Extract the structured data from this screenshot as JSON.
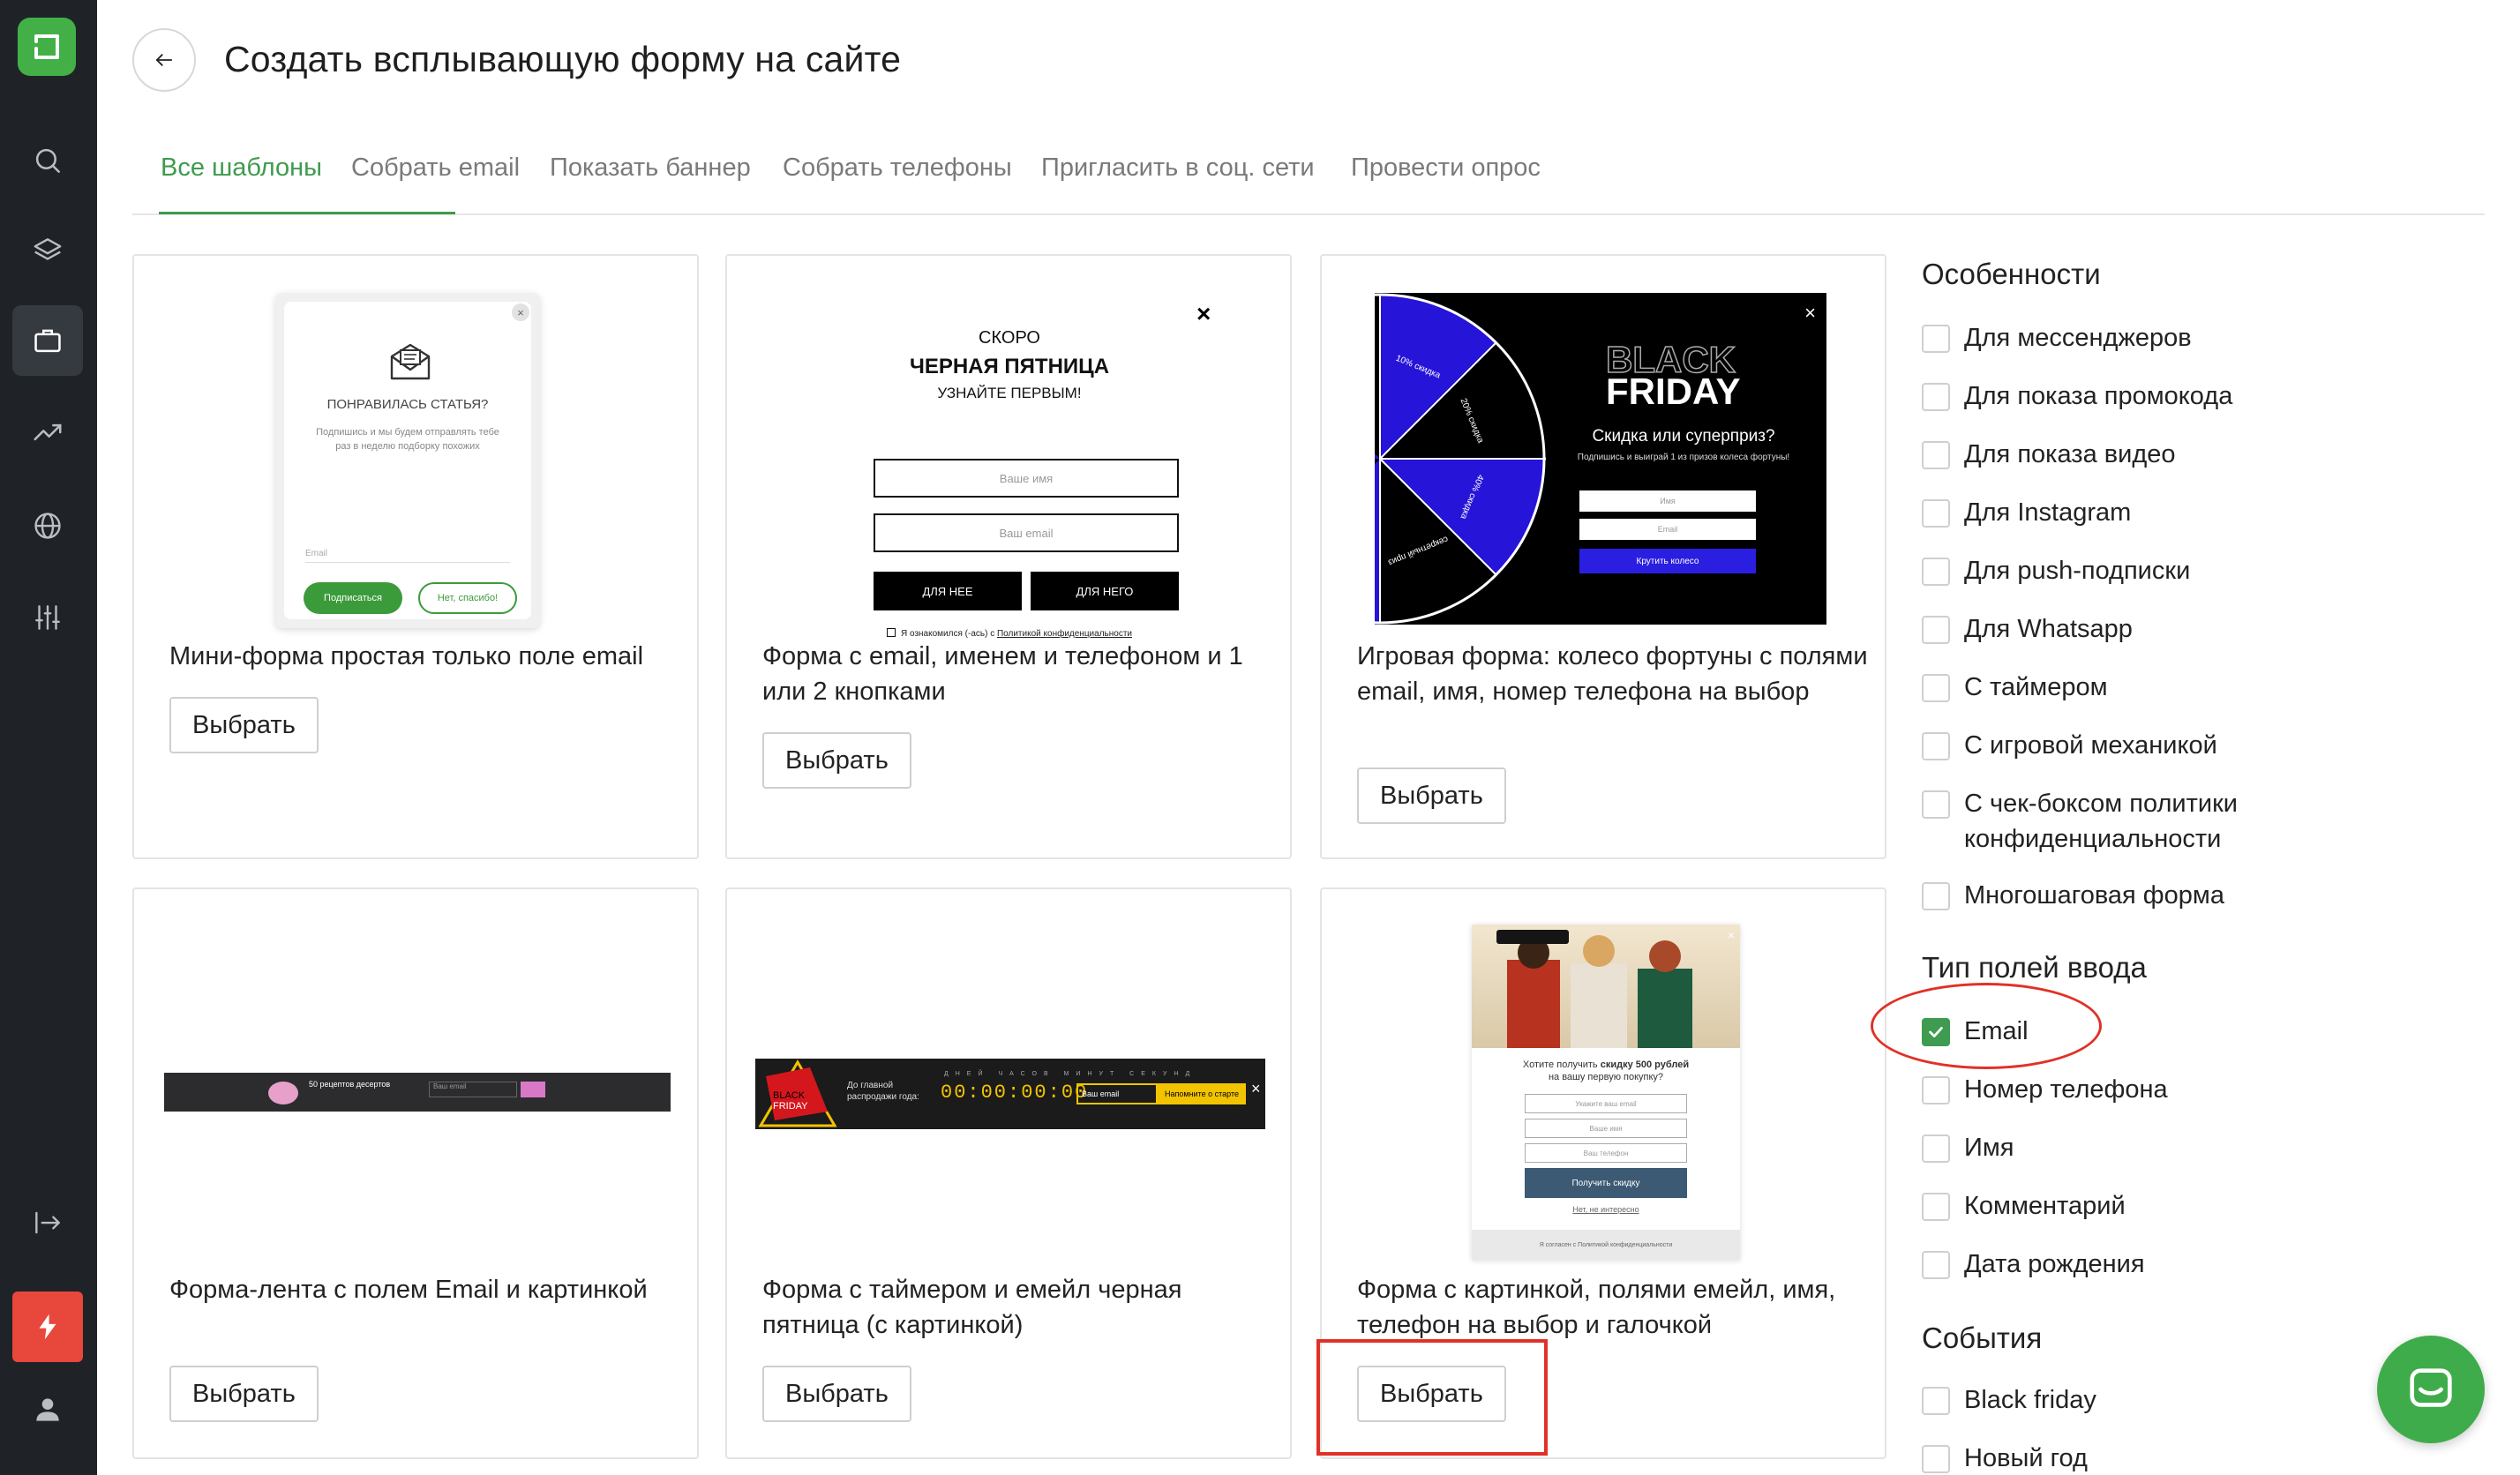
{
  "header": {
    "title": "Создать всплывающую форму на сайте"
  },
  "tabs": [
    {
      "label": "Все шаблоны",
      "active": true
    },
    {
      "label": "Собрать email"
    },
    {
      "label": "Показать баннер"
    },
    {
      "label": "Собрать телефоны"
    },
    {
      "label": "Пригласить в соц. сети"
    },
    {
      "label": "Провести опрос"
    }
  ],
  "choose_label": "Выбрать",
  "cards": [
    {
      "title": "Мини-форма простая только поле email",
      "preview": {
        "heading": "ПОНРАВИЛАСЬ СТАТЬЯ?",
        "text": "Подпишись и мы будем отправлять тебе раз в неделю подборку похожих",
        "email_placeholder": "Email",
        "yes": "Подписаться",
        "no": "Нет, спасибо!"
      }
    },
    {
      "title": "Форма с email, именем и телефоном и 1 или 2 кнопками",
      "preview": {
        "line1": "СКОРО",
        "line2": "ЧЕРНАЯ ПЯТНИЦА",
        "line3": "УЗНАЙТЕ ПЕРВЫМ!",
        "name_placeholder": "Ваше имя",
        "email_placeholder": "Ваш email",
        "btn_her": "ДЛЯ НЕЕ",
        "btn_him": "ДЛЯ НЕГО",
        "consent_prefix": "Я ознакомился (-ась) с",
        "consent_link": "Политикой конфиденциальности"
      }
    },
    {
      "title": "Игровая форма: колесо фортуны с полями email, имя, номер телефона на выбор",
      "preview": {
        "black": "BLACK",
        "friday": "FRIDAY",
        "question": "Скидка или суперприз?",
        "sub": "Подпишись и выиграй 1 из призов колеса фортуны!",
        "name_placeholder": "Имя",
        "email_placeholder": "Email",
        "spin": "Крутить колесо",
        "wheel_labels": [
          "10% скидка",
          "20% скидка",
          "40% скидка",
          "секретный приз",
          "10% скидка",
          "20% скидка",
          "40% скидка",
          "секретный приз"
        ]
      }
    },
    {
      "title": "Форма-лента с полем Email и картинкой",
      "preview": {
        "text": "50 рецептов десертов",
        "email_placeholder": "Ваш email"
      }
    },
    {
      "title": "Форма с таймером и емейл черная пятница (с картинкой)",
      "preview": {
        "badge_line1": "BLACK",
        "badge_line2": "FRIDAY",
        "text": "До главной распродажи года:",
        "timer_labels": "ДНЕЙ ЧАСОВ МИНУТ СЕКУНД",
        "timer": "00:00:00:00",
        "email_placeholder": "Ваш email",
        "btn": "Напомните о старте"
      }
    },
    {
      "title": "Форма с картинкой, полями емейл, имя, телефон на выбор и галочкой",
      "preview": {
        "question_prefix": "Хотите получить",
        "question_bold": "скидку 500 рублей",
        "question_suffix": "на вашу первую покупку?",
        "email_placeholder": "Укажите ваш email",
        "name_placeholder": "Ваше имя",
        "phone_placeholder": "Ваш телефон",
        "btn": "Получить скидку",
        "link": "Нет, не интересно",
        "footer": "Я согласен с Политикой конфиденциальности"
      }
    }
  ],
  "filters": {
    "features": {
      "heading": "Особенности",
      "items": [
        {
          "label": "Для мессенджеров",
          "checked": false
        },
        {
          "label": "Для показа промокода",
          "checked": false
        },
        {
          "label": "Для показа видео",
          "checked": false
        },
        {
          "label": "Для Instagram",
          "checked": false
        },
        {
          "label": "Для push-подписки",
          "checked": false
        },
        {
          "label": "Для Whatsapp",
          "checked": false
        },
        {
          "label": "С таймером",
          "checked": false
        },
        {
          "label": "С игровой механикой",
          "checked": false
        },
        {
          "label": "С чек-боксом политики конфиденциальности",
          "checked": false
        },
        {
          "label": "Многошаговая форма",
          "checked": false
        }
      ]
    },
    "field_types": {
      "heading": "Тип полей ввода",
      "items": [
        {
          "label": "Email",
          "checked": true
        },
        {
          "label": "Номер телефона",
          "checked": false
        },
        {
          "label": "Имя",
          "checked": false
        },
        {
          "label": "Комментарий",
          "checked": false
        },
        {
          "label": "Дата рождения",
          "checked": false
        }
      ]
    },
    "events": {
      "heading": "События",
      "items": [
        {
          "label": "Black friday",
          "checked": false
        },
        {
          "label": "Новый год",
          "checked": false
        }
      ]
    }
  },
  "colors": {
    "accent": "#3e9b50",
    "sidebar": "#1f2327",
    "annotation": "#e03127"
  }
}
